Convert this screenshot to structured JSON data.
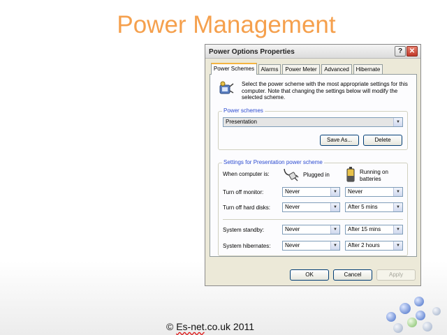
{
  "slide": {
    "title": "Power Management",
    "footer_prefix": "© ",
    "footer_brand": "Es-net",
    "footer_rest": ".co.uk 2011"
  },
  "dialog": {
    "title": "Power Options Properties",
    "help_glyph": "?",
    "close_glyph": "✕",
    "tabs": [
      {
        "label": "Power Schemes",
        "active": true
      },
      {
        "label": "Alarms",
        "active": false
      },
      {
        "label": "Power Meter",
        "active": false
      },
      {
        "label": "Advanced",
        "active": false
      },
      {
        "label": "Hibernate",
        "active": false
      }
    ],
    "description": "Select the power scheme with the most appropriate settings for this computer. Note that changing the settings below will modify the selected scheme.",
    "schemes_group": {
      "label": "Power schemes",
      "selected": "Presentation",
      "save_as": "Save As...",
      "delete": "Delete"
    },
    "settings_group": {
      "label": "Settings for Presentation power scheme",
      "when_label": "When computer is:",
      "plugged_label": "Plugged in",
      "battery_label": "Running on batteries",
      "rows": [
        {
          "label": "Turn off monitor:",
          "plugged": "Never",
          "battery": "Never"
        },
        {
          "label": "Turn off hard disks:",
          "plugged": "Never",
          "battery": "After 5 mins"
        },
        {
          "label": "System standby:",
          "plugged": "Never",
          "battery": "After 15 mins"
        },
        {
          "label": "System hibernates:",
          "plugged": "Never",
          "battery": "After 2 hours"
        }
      ]
    },
    "buttons": {
      "ok": "OK",
      "cancel": "Cancel",
      "apply": "Apply"
    }
  },
  "colors": {
    "title_orange": "#f5a04d",
    "xp_face": "#ece9d8",
    "group_label_blue": "#2c4bd0"
  }
}
